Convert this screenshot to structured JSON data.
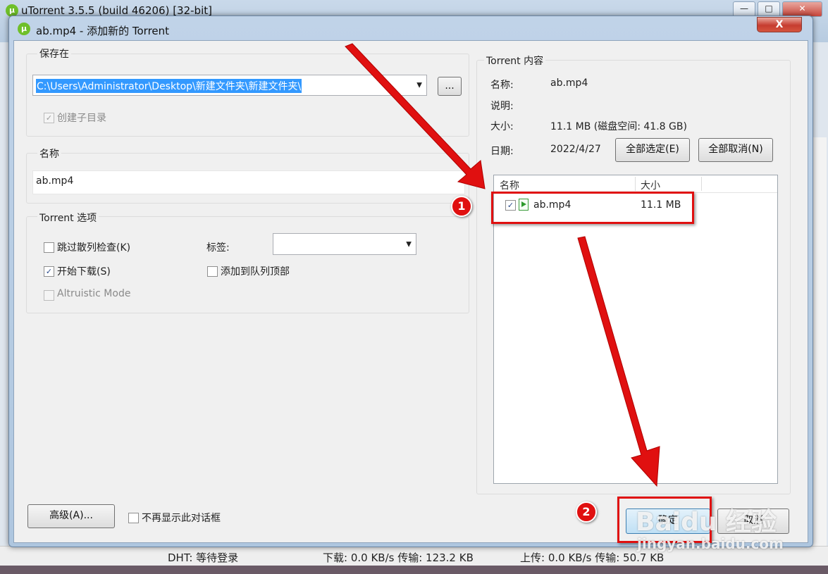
{
  "background": {
    "title": "uTorrent 3.5.5  (build 46206) [32-bit]",
    "status": {
      "dht": "DHT: 等待登录",
      "download": "下载: 0.0 KB/s 传输: 123.2 KB",
      "upload": "上传: 0.0 KB/s 传输: 50.7 KB"
    }
  },
  "dialog": {
    "title": "ab.mp4 - 添加新的 Torrent",
    "close_label": "X",
    "save_in": {
      "label": "保存在",
      "path": "C:\\Users\\Administrator\\Desktop\\新建文件夹\\新建文件夹\\",
      "browse_label": "...",
      "subdir_label": "创建子目录"
    },
    "name": {
      "label": "名称",
      "value": "ab.mp4"
    },
    "options": {
      "label": "Torrent 选项",
      "skip_hash": "跳过散列检查(K)",
      "start_download": "开始下载(S)",
      "altruistic": "Altruistic Mode",
      "tag_label": "标签:",
      "add_top": "添加到队列顶部"
    },
    "advanced_label": "高级(A)...",
    "no_show_label": "不再显示此对话框",
    "content": {
      "label": "Torrent 内容",
      "name_key": "名称:",
      "name_val": "ab.mp4",
      "desc_key": "说明:",
      "size_key": "大小:",
      "size_val": "11.1 MB (磁盘空间: 41.8 GB)",
      "date_key": "日期:",
      "date_val": "2022/4/27",
      "select_all": "全部选定(E)",
      "deselect_all": "全部取消(N)",
      "columns": [
        "名称",
        "大小"
      ],
      "files": [
        {
          "name": "ab.mp4",
          "size": "11.1 MB"
        }
      ]
    },
    "ok_label": "确定",
    "cancel_label": "取消"
  },
  "annotations": {
    "badge1": "1",
    "badge2": "2"
  },
  "watermark": {
    "brand": "Baidu 经验",
    "url": "jingyan.baidu.com"
  }
}
